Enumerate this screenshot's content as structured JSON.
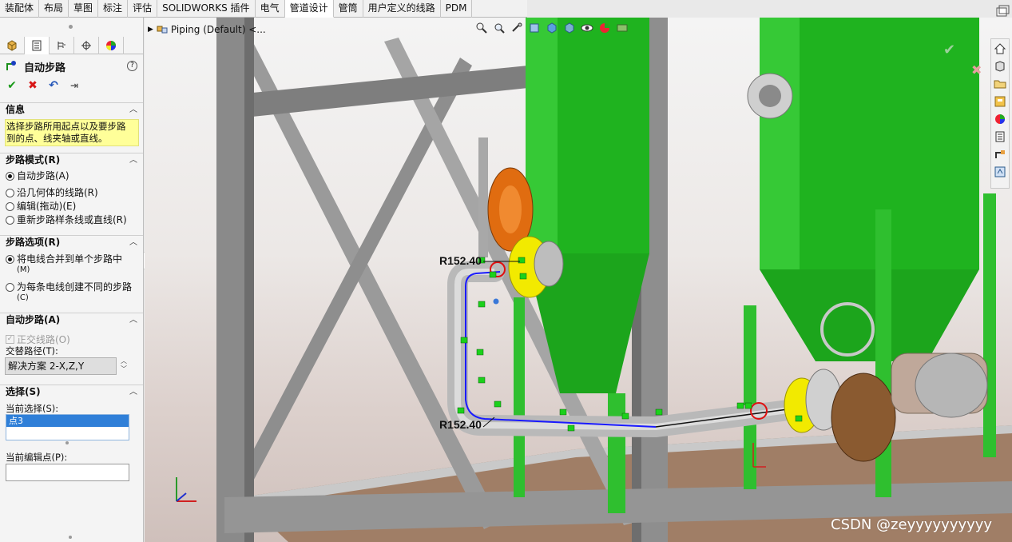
{
  "tabs": [
    "装配体",
    "布局",
    "草图",
    "标注",
    "评估",
    "SOLIDWORKS 插件",
    "电气",
    "管道设计",
    "管筒",
    "用户定义的线路",
    "PDM"
  ],
  "active_tab": "管道设计",
  "feature": {
    "title": "自动步路",
    "help": "?",
    "ok_icon": "check-icon",
    "cancel_icon": "x-icon",
    "undo_icon": "undo-icon",
    "pin_icon": "pin-icon"
  },
  "info": {
    "header": "信息",
    "text_line1": "选择步路所用起点以及要步路",
    "text_line2": "到的点、线夹轴或直线。"
  },
  "routing_mode": {
    "header": "步路模式(R)",
    "options": [
      {
        "label": "自动步路(A)",
        "selected": true
      },
      {
        "label": "沿几何体的线路(R)",
        "selected": false
      },
      {
        "label": "编辑(拖动)(E)",
        "selected": false
      },
      {
        "label": "重新步路样条线或直线(R)",
        "selected": false
      }
    ]
  },
  "routing_options": {
    "header": "步路选项(R)",
    "opt1_line1": "将电线合并到单个步路中",
    "opt1_line2": "(M)",
    "opt2_line1": "为每条电线创建不同的步路",
    "opt2_line2": "(C)"
  },
  "auto_route": {
    "header": "自动步路(A)",
    "orthogonal_label": "正交线路(O)",
    "alt_path_label": "交替路径(T):",
    "solution_value": "解决方案 2-X,Z,Y"
  },
  "selection": {
    "header": "选择(S)",
    "current_label": "当前选择(S):",
    "current_item": "点3",
    "edit_point_label": "当前编辑点(P):",
    "edit_point_value": ""
  },
  "viewport": {
    "breadcrumb": "Piping (Default) <...",
    "dim1": "R152.40",
    "dim2": "R152.40",
    "watermark": "CSDN @zeyyyyyyyyyy"
  },
  "colors": {
    "tank_green": "#1fb31f",
    "frame_gray": "#8c8c8c",
    "route_blue": "#1a1aff",
    "flange_yellow": "#f2ea00",
    "info_yellow": "#ffff99",
    "selection_blue": "#2f7fd8"
  }
}
